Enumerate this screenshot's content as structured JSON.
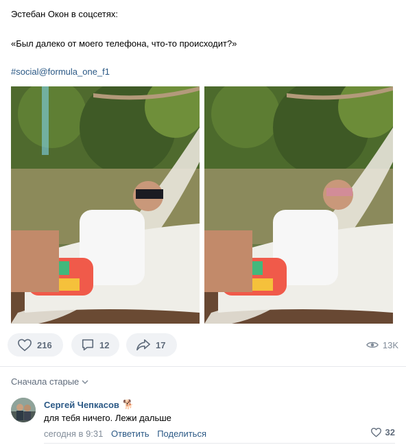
{
  "post": {
    "line1": "Эстебан Окон в соцсетях:",
    "line2": "«Был далеко от моего телефона, что-то происходит?»",
    "hashtag": "#social@formula_one_f1"
  },
  "actions": {
    "likes": "216",
    "comments": "12",
    "shares": "17",
    "views": "13K",
    "icons": [
      "heart-icon",
      "comment-icon",
      "share-icon",
      "eye-icon"
    ]
  },
  "comments_section": {
    "sort_label": "Сначала старые"
  },
  "comment": {
    "author": "Сергей Чепкасов",
    "author_badge": "🐕",
    "text": "для тебя ничего. Лежи дальше",
    "time": "сегодня в 9:31",
    "reply_label": "Ответить",
    "share_label": "Поделиться",
    "likes": "32"
  },
  "colors": {
    "link": "#2a5885",
    "pill_bg": "#f0f2f5",
    "muted": "#818c99"
  }
}
